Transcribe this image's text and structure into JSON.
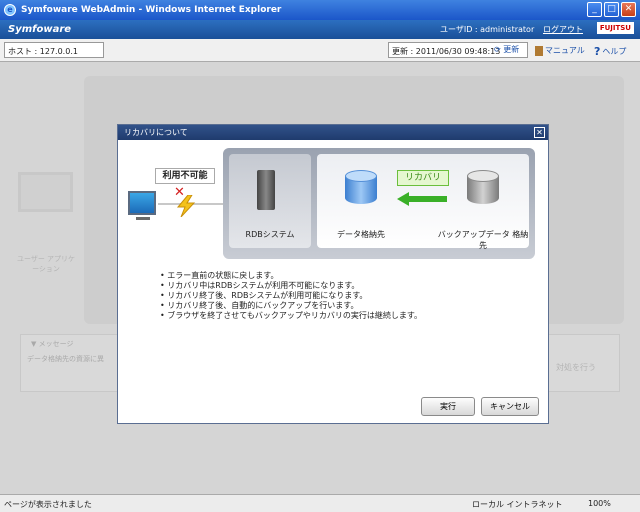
{
  "window": {
    "title": "Symfoware WebAdmin - Windows Internet Explorer"
  },
  "app": {
    "brand": "Symfoware",
    "user_label": "ユーザID : administrator",
    "logout": "ログアウト",
    "vendor": "FUJITSU"
  },
  "toolbar": {
    "host": "ホスト : 127.0.0.1",
    "updated": "更新 : 2011/06/30 09:48:13",
    "refresh": "更新",
    "manual": "マニュアル",
    "help": "ヘルプ"
  },
  "background": {
    "client_label": "ユーザー アプリケーション",
    "message_title": "▼ メッセージ",
    "message_text": "データ格納先の資源に異",
    "action": "対処を行う"
  },
  "dialog": {
    "title": "リカバリについて",
    "unavailable": "利用不可能",
    "rdb_label": "RDBシステム",
    "recovery_badge": "リカバリ",
    "data_store": "データ格納先",
    "backup_store": "バックアップデータ 格納先",
    "info": [
      "エラー直前の状態に戻します。",
      "リカバリ中はRDBシステムが利用不可能になります。",
      "リカバリ終了後、RDBシステムが利用可能になります。",
      "リカバリ終了後、自動的にバックアップを行います。",
      "ブラウザを終了させてもバックアップやリカバリの実行は継続します。"
    ],
    "execute": "実行",
    "cancel": "キャンセル"
  },
  "statusbar": {
    "text": "ページが表示されました",
    "zone": "ローカル イントラネット",
    "zoom": "100%"
  }
}
